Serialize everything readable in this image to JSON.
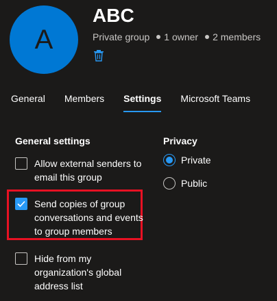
{
  "group": {
    "avatar_letter": "A",
    "name": "ABC",
    "type": "Private group",
    "owners": "1 owner",
    "members": "2 members",
    "delete_icon": "trash-icon"
  },
  "tabs": [
    {
      "label": "General",
      "active": false
    },
    {
      "label": "Members",
      "active": false
    },
    {
      "label": "Settings",
      "active": true
    },
    {
      "label": "Microsoft Teams",
      "active": false
    }
  ],
  "general_settings": {
    "title": "General settings",
    "options": [
      {
        "label": "Allow external senders to email this group",
        "checked": false
      },
      {
        "label": "Send copies of group conversations and events to group members",
        "checked": true,
        "highlighted": true
      },
      {
        "label": "Hide from my organization's global address list",
        "checked": false
      }
    ]
  },
  "privacy": {
    "title": "Privacy",
    "options": [
      {
        "label": "Private",
        "selected": true
      },
      {
        "label": "Public",
        "selected": false
      }
    ]
  },
  "colors": {
    "background": "#1b1a19",
    "accent": "#2899f5",
    "avatar": "#0078d4",
    "highlight_box": "#e81123"
  }
}
